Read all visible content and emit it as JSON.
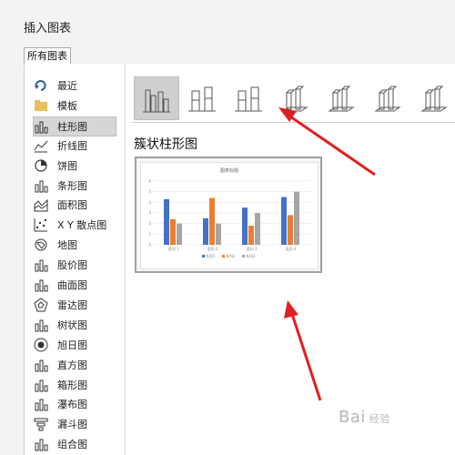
{
  "dialog": {
    "title": "插入图表",
    "tab_label": "所有图表",
    "subtype_title": "簇状柱形图"
  },
  "sidebar": {
    "items": [
      {
        "label": "最近",
        "icon": "recent-icon"
      },
      {
        "label": "模板",
        "icon": "folder-icon"
      },
      {
        "label": "柱形图",
        "icon": "column-chart-icon",
        "selected": true
      },
      {
        "label": "折线图",
        "icon": "line-chart-icon"
      },
      {
        "label": "饼图",
        "icon": "pie-chart-icon"
      },
      {
        "label": "条形图",
        "icon": "bar-chart-icon"
      },
      {
        "label": "面积图",
        "icon": "area-chart-icon"
      },
      {
        "label": "X Y 散点图",
        "icon": "scatter-chart-icon"
      },
      {
        "label": "地图",
        "icon": "map-chart-icon"
      },
      {
        "label": "股价图",
        "icon": "stock-chart-icon"
      },
      {
        "label": "曲面图",
        "icon": "surface-chart-icon"
      },
      {
        "label": "雷达图",
        "icon": "radar-chart-icon"
      },
      {
        "label": "树状图",
        "icon": "treemap-chart-icon"
      },
      {
        "label": "旭日图",
        "icon": "sunburst-chart-icon"
      },
      {
        "label": "直方图",
        "icon": "histogram-chart-icon"
      },
      {
        "label": "箱形图",
        "icon": "box-whisker-chart-icon"
      },
      {
        "label": "瀑布图",
        "icon": "waterfall-chart-icon"
      },
      {
        "label": "漏斗图",
        "icon": "funnel-chart-icon"
      },
      {
        "label": "组合图",
        "icon": "combo-chart-icon"
      }
    ]
  },
  "subtypes": [
    {
      "icon": "clustered-column-icon",
      "selected": true
    },
    {
      "icon": "stacked-column-icon"
    },
    {
      "icon": "percent-stacked-column-icon"
    },
    {
      "icon": "3d-clustered-column-icon"
    },
    {
      "icon": "3d-stacked-column-icon"
    },
    {
      "icon": "3d-percent-stacked-column-icon"
    },
    {
      "icon": "3d-column-icon"
    }
  ],
  "colors": {
    "series1": "#4472c4",
    "series2": "#ed7d31",
    "series3": "#a5a5a5",
    "arrow": "#e02020"
  },
  "watermark": {
    "text": "Bai",
    "sub": "经验"
  },
  "chart_data": {
    "type": "bar",
    "title": "图表标题",
    "categories": [
      "类别 1",
      "类别 2",
      "类别 3",
      "类别 4"
    ],
    "series": [
      {
        "name": "系列1",
        "values": [
          4.3,
          2.5,
          3.5,
          4.5
        ]
      },
      {
        "name": "系列2",
        "values": [
          2.4,
          4.4,
          1.8,
          2.8
        ]
      },
      {
        "name": "系列3",
        "values": [
          2,
          2,
          3,
          5
        ]
      }
    ],
    "yticks": [
      "0",
      "1",
      "2",
      "3",
      "4",
      "5",
      "6"
    ],
    "ylim": [
      0,
      6
    ],
    "grid": true,
    "legend": "bottom"
  }
}
